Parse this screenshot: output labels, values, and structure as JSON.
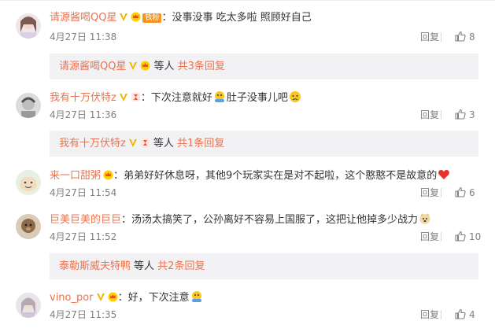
{
  "comments": [
    {
      "user": "请源酱喝QQ星",
      "fan_tag": "铁粉",
      "text": "：没事没事  吃太多啦 照顾好自己",
      "time": "4月27日 11:38",
      "reply_label": "回复",
      "likes": "8",
      "sub": {
        "user": "请源酱喝QQ星",
        "etc": "等人",
        "more": "共3条回复"
      }
    },
    {
      "user": "我有十万伏特z",
      "text1": "：下次注意就好",
      "text2": "肚子没事儿吧",
      "time": "4月27日 11:36",
      "reply_label": "回复",
      "likes": "3",
      "sub": {
        "user": "我有十万伏特z",
        "etc": "等人",
        "more": "共1条回复"
      }
    },
    {
      "user": "来一口甜粥",
      "text": "：弟弟好好休息呀，其他9个玩家实在是对不起啦，这个憨憨不是故意的",
      "time": "4月27日 11:54",
      "reply_label": "回复",
      "likes": "6"
    },
    {
      "user": "巨美巨美的巨巨",
      "text": "：汤汤太搞笑了，公孙离好不容易上国服了，这把让他掉多少战力",
      "time": "4月27日 11:52",
      "reply_label": "回复",
      "likes": "10",
      "sub": {
        "user": "泰勒斯威夫特鸭",
        "etc": "等人",
        "more": "共2条回复"
      }
    },
    {
      "user": "vino_por",
      "text": "：好，下次注意",
      "time": "4月27日 11:35",
      "reply_label": "回复",
      "likes": "4"
    }
  ],
  "colors": {
    "username": "#eb7350",
    "meta": "#808080",
    "subbox": "#f2f2f5"
  }
}
